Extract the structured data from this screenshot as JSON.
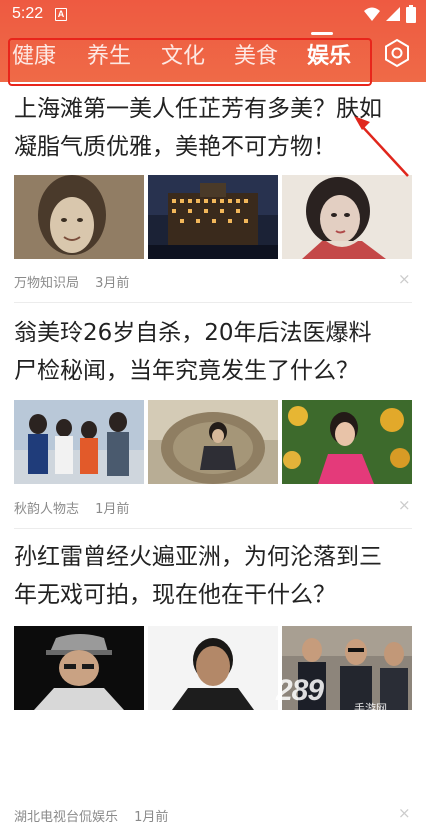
{
  "status_bar": {
    "time": "5:22",
    "app_badge": "A"
  },
  "tabs": [
    {
      "label": "健康"
    },
    {
      "label": "养生"
    },
    {
      "label": "文化"
    },
    {
      "label": "美食"
    },
    {
      "label": "娱乐"
    }
  ],
  "active_tab": "娱乐",
  "colors": {
    "header": "#ee5a41",
    "highlight": "#e8251b",
    "text": "#222222",
    "meta": "#8a8a8a"
  },
  "articles": [
    {
      "title_line1": "上海滩第一美人任芷芳有多美？肤如",
      "title_line2": "凝脂气质优雅，美艳不可方物！",
      "source": "万物知识局",
      "time": "3月前"
    },
    {
      "title_line1": "翁美玲26岁自杀，20年后法医爆料",
      "title_line2": "尸检秘闻，当年究竟发生了什么？",
      "source": "秋韵人物志",
      "time": "1月前"
    },
    {
      "title_line1": "孙红雷曾经火遍亚洲，为何沦落到三",
      "title_line2": "年无戏可拍，现在他在干什么？",
      "source": "湖北电视台侃娱乐",
      "time": "1月前"
    }
  ],
  "dismiss_glyph": "×",
  "watermark": {
    "main": "289",
    "sub": "手游网"
  }
}
